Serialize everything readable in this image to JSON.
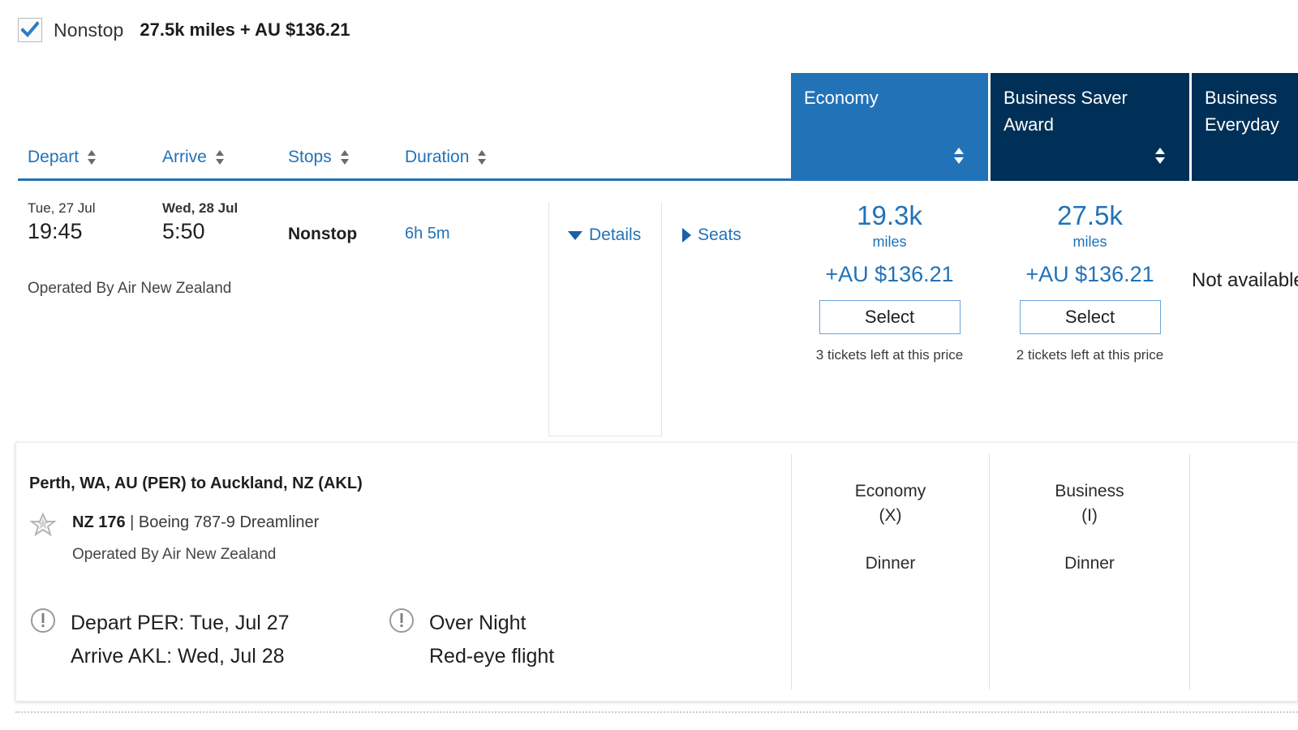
{
  "filter": {
    "checkbox_checked": true,
    "label": "Nonstop",
    "price_summary": "27.5k miles + AU $136.21"
  },
  "fare_columns": [
    {
      "title": "Economy",
      "bg": "#2272b8",
      "sortable": true
    },
    {
      "title": "Business Saver Award",
      "bg": "#003057",
      "sortable": true
    },
    {
      "title": "Business Everyday",
      "bg": "#003057",
      "sortable": false,
      "clipped": true
    }
  ],
  "sort_headers": [
    {
      "label": "Depart"
    },
    {
      "label": "Arrive"
    },
    {
      "label": "Stops"
    },
    {
      "label": "Duration"
    }
  ],
  "flight_row": {
    "depart_date": "Tue, 27 Jul",
    "depart_time": "19:45",
    "arrive_date": "Wed, 28 Jul",
    "arrive_time": "5:50",
    "stops": "Nonstop",
    "duration": "6h 5m",
    "operated_by": "Operated By Air New Zealand",
    "details_toggle": "Details",
    "seats_toggle": "Seats"
  },
  "fares": [
    {
      "miles": "19.3k",
      "miles_label": "miles",
      "cash": "+AU $136.21",
      "button": "Select",
      "availability": "3 tickets left at this price"
    },
    {
      "miles": "27.5k",
      "miles_label": "miles",
      "cash": "+AU $136.21",
      "button": "Select",
      "availability": "2 tickets left at this price"
    },
    {
      "unavailable_text": "Not available"
    }
  ],
  "details_panel": {
    "route": "Perth, WA, AU (PER) to Auckland, NZ (AKL)",
    "flight_number": "NZ 176",
    "separator": " | ",
    "aircraft": "Boeing 787-9 Dreamliner",
    "operated_by": "Operated By Air New Zealand",
    "notices": [
      {
        "line1": "Depart PER: Tue, Jul 27",
        "line2": "Arrive AKL: Wed, Jul 28"
      },
      {
        "line1": "Over Night",
        "line2": "Red-eye flight"
      }
    ],
    "cabins": [
      {
        "name": "Economy",
        "code": "(X)",
        "meal": "Dinner"
      },
      {
        "name": "Business",
        "code": "(I)",
        "meal": "Dinner"
      },
      {
        "name": "",
        "code": "",
        "meal": ""
      }
    ]
  },
  "colors": {
    "accent_blue": "#2272b8",
    "navy": "#003057",
    "link_blue": "#2272b8"
  }
}
